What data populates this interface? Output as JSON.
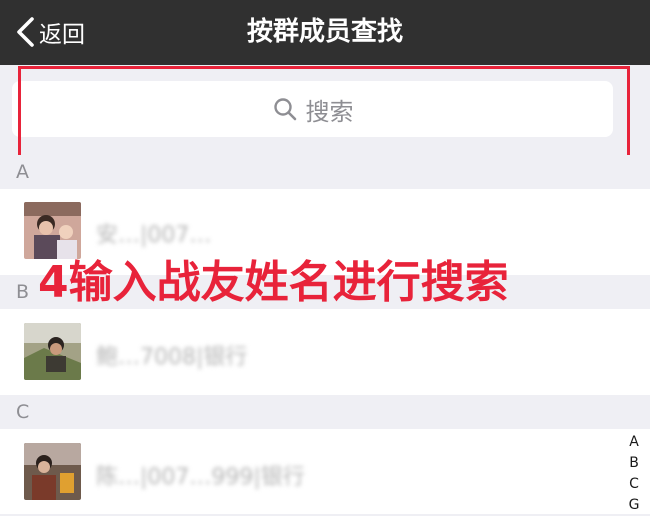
{
  "nav": {
    "back_label": "返回",
    "title": "按群成员查找"
  },
  "search": {
    "placeholder": "搜索"
  },
  "sections": [
    {
      "letter": "A",
      "member": "安…|007…"
    },
    {
      "letter": "B",
      "member": "鲍…7008|银行"
    },
    {
      "letter": "C",
      "member": "陈…|007…999|银行"
    }
  ],
  "annotation": "4输入战友姓名进行搜索",
  "index_letters": [
    "A",
    "B",
    "C",
    "G"
  ],
  "colors": {
    "nav_bg": "#303030",
    "annotation": "#e8233a",
    "page_bg": "#efeff4"
  }
}
